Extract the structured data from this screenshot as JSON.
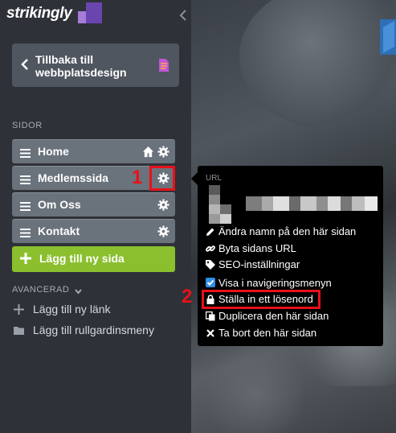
{
  "app": {
    "logo_text": "strikingly"
  },
  "back_button": {
    "label": "Tillbaka till webbplatsdesign"
  },
  "sections": {
    "pages_label": "SIDOR",
    "advanced_label": "AVANCERAD"
  },
  "pages": [
    {
      "label": "Home"
    },
    {
      "label": "Medlemssida"
    },
    {
      "label": "Om Oss"
    },
    {
      "label": "Kontakt"
    }
  ],
  "add_page": {
    "label": "Lägg till ny sida"
  },
  "advanced": {
    "add_link": "Lägg till ny länk",
    "add_dropdown": "Lägg till rullgardinsmeny"
  },
  "popover": {
    "url_label": "URL",
    "items": [
      {
        "label": "Ändra namn på den här sidan",
        "icon": "pencil-icon"
      },
      {
        "label": "Byta sidans URL",
        "icon": "link-icon"
      },
      {
        "label": "SEO-inställningar",
        "icon": "tag-icon"
      },
      {
        "label": "Visa i navigeringsmenyn",
        "icon": "checkbox-icon",
        "checked": true
      },
      {
        "label": "Ställa in ett lösenord",
        "icon": "lock-icon"
      },
      {
        "label": "Duplicera den här sidan",
        "icon": "copy-icon"
      },
      {
        "label": "Ta bort den här sidan",
        "icon": "x-icon"
      }
    ]
  },
  "annotations": {
    "step1": "1",
    "step2": "2"
  },
  "colors": {
    "sidebar": "#2e3238",
    "page_item": "#6a727c",
    "add_green": "#8bbf2e",
    "annotation_red": "#e8101a",
    "checkbox_blue": "#2f8ee5"
  }
}
